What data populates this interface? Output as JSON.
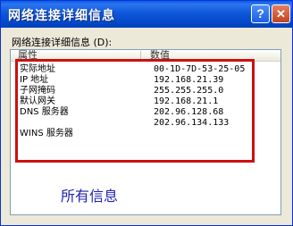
{
  "window": {
    "title": "网络连接详细信息",
    "help_glyph": "?",
    "close_glyph": "✕"
  },
  "dialog": {
    "label": "网络连接详细信息 (D):"
  },
  "list": {
    "columns": [
      "属性",
      "数值"
    ],
    "rows": [
      {
        "property": "实际地址",
        "value": "00-1D-7D-53-25-05"
      },
      {
        "property": "IP 地址",
        "value": "192.168.21.39"
      },
      {
        "property": "子网掩码",
        "value": "255.255.255.0"
      },
      {
        "property": "默认网关",
        "value": "192.168.21.1"
      },
      {
        "property": "DNS 服务器",
        "value": "202.96.128.68"
      },
      {
        "property": "",
        "value": "202.96.134.133"
      },
      {
        "property": "WINS 服务器",
        "value": ""
      }
    ]
  },
  "annotation": {
    "text": "所有信息",
    "box_color": "#cc1010",
    "text_color": "#2121b5"
  }
}
